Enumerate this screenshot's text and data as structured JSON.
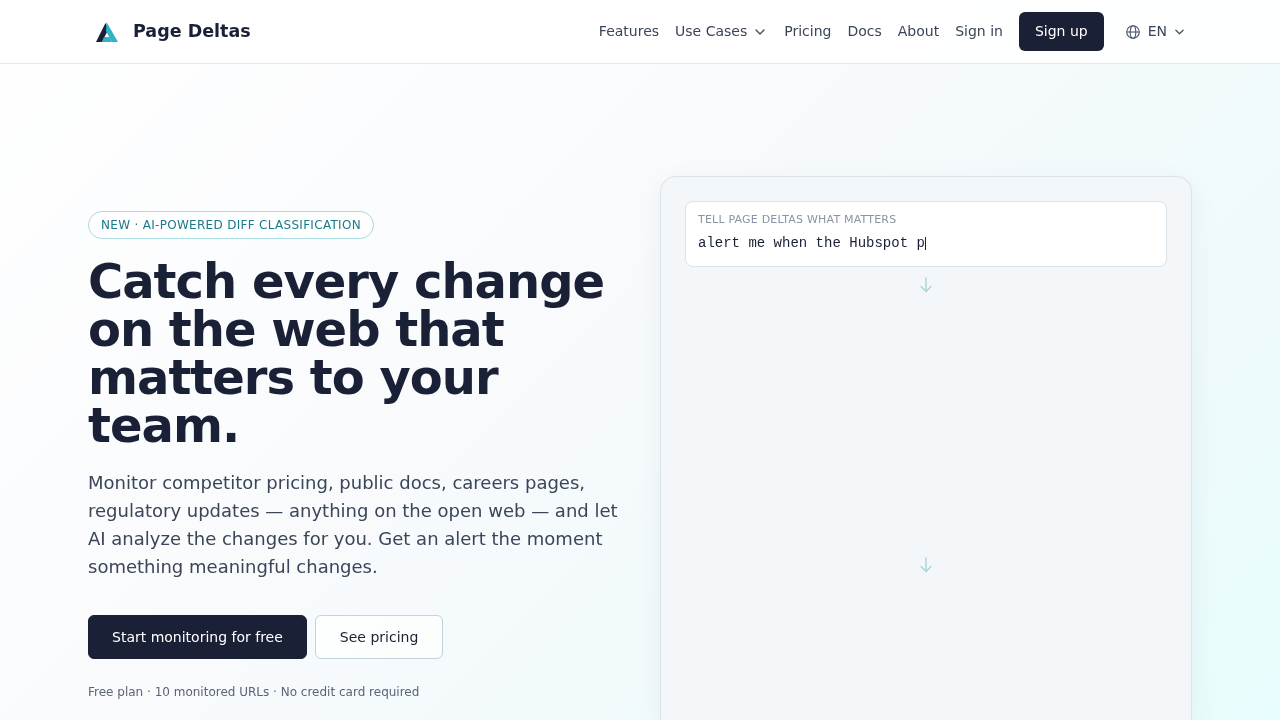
{
  "navbar": {
    "brand": "Page Deltas",
    "links": [
      {
        "label": "Features",
        "kind": "link"
      },
      {
        "label": "Use Cases",
        "kind": "dropdown"
      },
      {
        "label": "Pricing",
        "kind": "link"
      },
      {
        "label": "Docs",
        "kind": "link"
      },
      {
        "label": "About",
        "kind": "link"
      },
      {
        "label": "Sign in",
        "kind": "link"
      },
      {
        "label": "Sign up",
        "kind": "button"
      }
    ],
    "language": "EN"
  },
  "hero": {
    "badge": "NEW · AI-POWERED DIFF CLASSIFICATION",
    "headline": "Catch every change on the web that matters to your team.",
    "description": "Monitor competitor pricing, public docs, careers pages, regulatory updates — anything on the open web — and let AI analyze the changes for you. Get an alert the moment something meaningful changes.",
    "buttons": [
      {
        "label": "Start monitoring for free",
        "kind": "primary"
      },
      {
        "label": "See pricing",
        "kind": "outline"
      }
    ],
    "note": "Free plan · 10 monitored URLs · No credit card required"
  },
  "demo": {
    "prompt_label": "TELL PAGE DELTAS WHAT MATTERS",
    "prompt_value": "alert me when the Hubspot p"
  }
}
